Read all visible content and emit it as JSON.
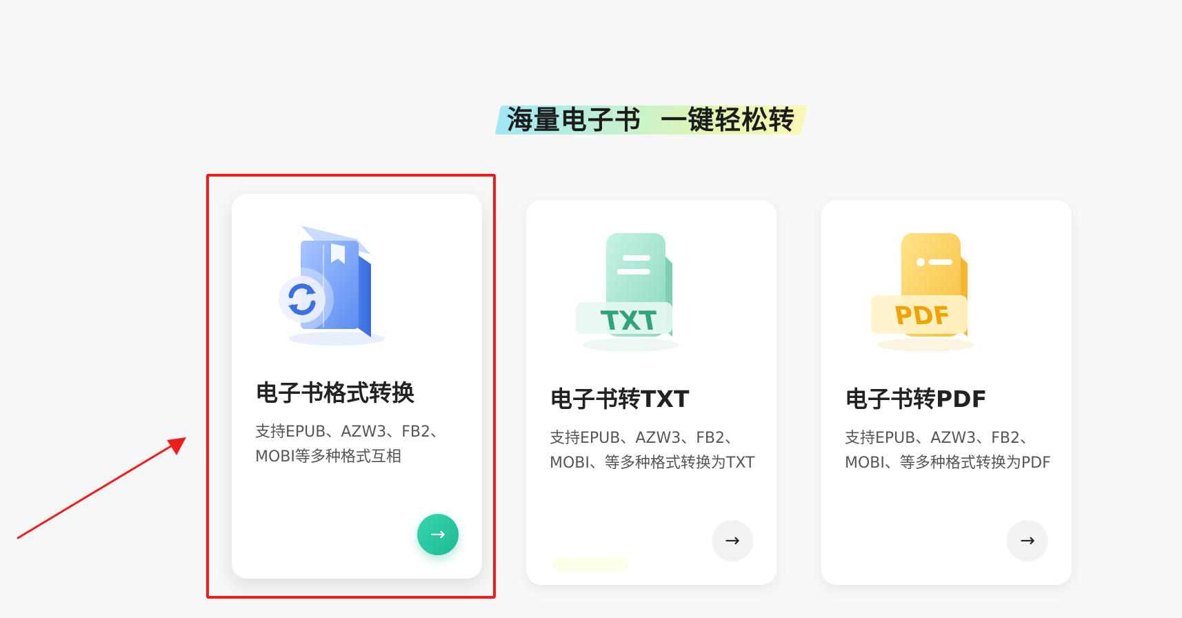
{
  "heading": {
    "text": "海量电子书  一键轻松转"
  },
  "cards": [
    {
      "title": "电子书格式转换",
      "desc": "支持EPUB、AZW3、FB2、MOBI等多种格式互相",
      "icon": "book-convert-icon",
      "accent": "#6b9cf5",
      "selected": true
    },
    {
      "title": "电子书转TXT",
      "desc": "支持EPUB、AZW3、FB2、MOBI、等多种格式转换为TXT",
      "icon": "txt-file-icon",
      "badge": "TXT",
      "accent": "#7fd9bd"
    },
    {
      "title": "电子书转PDF",
      "desc": "支持EPUB、AZW3、FB2、MOBI、等多种格式转换为PDF",
      "icon": "pdf-file-icon",
      "badge": "PDF",
      "accent": "#fbc94b"
    }
  ],
  "arrow_glyph": "→",
  "colors": {
    "highlight_border": "#ee1c1c",
    "annotation_arrow": "#ee1c1c",
    "active_button": "#22c2a0",
    "background": "#f7f7f7"
  }
}
